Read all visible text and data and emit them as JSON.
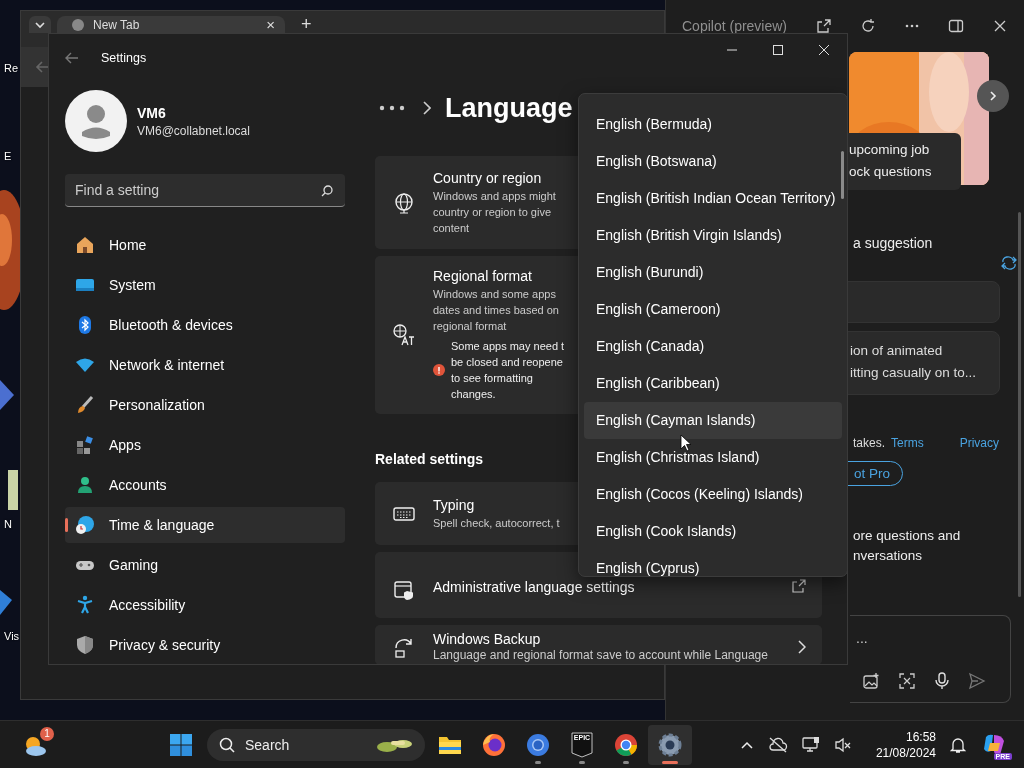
{
  "desktop": {
    "icons": [
      {
        "label": "Re"
      },
      {
        "label": "E"
      },
      {
        "label": "N"
      },
      {
        "label": "Vis"
      }
    ]
  },
  "browser": {
    "tab": {
      "title": "New Tab",
      "close": "×"
    },
    "new_tab": "+"
  },
  "copilot": {
    "title": "Copilot (preview)",
    "hero_caption": "upcoming job\nock questions",
    "prompt_heading": "a suggestion",
    "suggestion_card": "ion of animated\nitting casually on to...",
    "footer": {
      "text": "takes.",
      "links": [
        "Terms",
        "Privacy"
      ]
    },
    "pro_button": "ot Pro",
    "signin_text": "ore questions and\nnversations",
    "input": {
      "placeholder": "..."
    }
  },
  "settings": {
    "title": "Settings",
    "user": {
      "name": "VM6",
      "email": "VM6@collabnet.local"
    },
    "search": {
      "placeholder": "Find a setting"
    },
    "nav": [
      {
        "label": "Home",
        "selected": false
      },
      {
        "label": "System",
        "selected": false
      },
      {
        "label": "Bluetooth & devices",
        "selected": false
      },
      {
        "label": "Network & internet",
        "selected": false
      },
      {
        "label": "Personalization",
        "selected": false
      },
      {
        "label": "Apps",
        "selected": false
      },
      {
        "label": "Accounts",
        "selected": false
      },
      {
        "label": "Time & language",
        "selected": true
      },
      {
        "label": "Gaming",
        "selected": false
      },
      {
        "label": "Accessibility",
        "selected": false
      },
      {
        "label": "Privacy & security",
        "selected": false
      }
    ],
    "page_title": "Language",
    "region_cards": [
      {
        "title": "Country or region",
        "description": "Windows and apps might\ncountry or region to give\ncontent"
      },
      {
        "title": "Regional format",
        "description": "Windows and some apps\ndates and times based on\nregional format",
        "note": "Some apps may need t\nbe closed and reopene\nto see formatting\nchanges."
      }
    ],
    "related": {
      "heading": "Related settings",
      "items": [
        {
          "title": "Typing",
          "description": "Spell check, autocorrect, t"
        },
        {
          "title": "Administrative language settings"
        },
        {
          "title": "Windows Backup",
          "description": "Language and regional format save to account while Language"
        }
      ]
    },
    "region_dropdown": {
      "items": [
        {
          "label": "English (Bermuda)",
          "hovered": false
        },
        {
          "label": "English (Botswana)",
          "hovered": false
        },
        {
          "label": "English (British Indian Ocean Territory)",
          "hovered": false
        },
        {
          "label": "English (British Virgin Islands)",
          "hovered": false
        },
        {
          "label": "English (Burundi)",
          "hovered": false
        },
        {
          "label": "English (Cameroon)",
          "hovered": false
        },
        {
          "label": "English (Canada)",
          "hovered": false
        },
        {
          "label": "English (Caribbean)",
          "hovered": false
        },
        {
          "label": "English (Cayman Islands)",
          "hovered": true
        },
        {
          "label": "English (Christmas Island)",
          "hovered": false
        },
        {
          "label": "English (Cocos (Keeling) Islands)",
          "hovered": false
        },
        {
          "label": "English (Cook Islands)",
          "hovered": false
        },
        {
          "label": "English (Cyprus)",
          "hovered": false
        }
      ]
    }
  },
  "taskbar": {
    "weather": {
      "badge": "1"
    },
    "search": {
      "label": "Search"
    },
    "apps": [
      {
        "kind": "explorer",
        "running": false,
        "active": false
      },
      {
        "kind": "firefox",
        "running": false,
        "active": false
      },
      {
        "kind": "chromium",
        "running": true,
        "active": false
      },
      {
        "kind": "epic",
        "label": "EPIC",
        "running": true,
        "active": false
      },
      {
        "kind": "chrome",
        "running": true,
        "active": false
      },
      {
        "kind": "settings",
        "running": true,
        "active": true
      }
    ],
    "clock": {
      "time": "16:58",
      "date": "21/08/2024"
    },
    "copilot_badge": "PRE"
  }
}
